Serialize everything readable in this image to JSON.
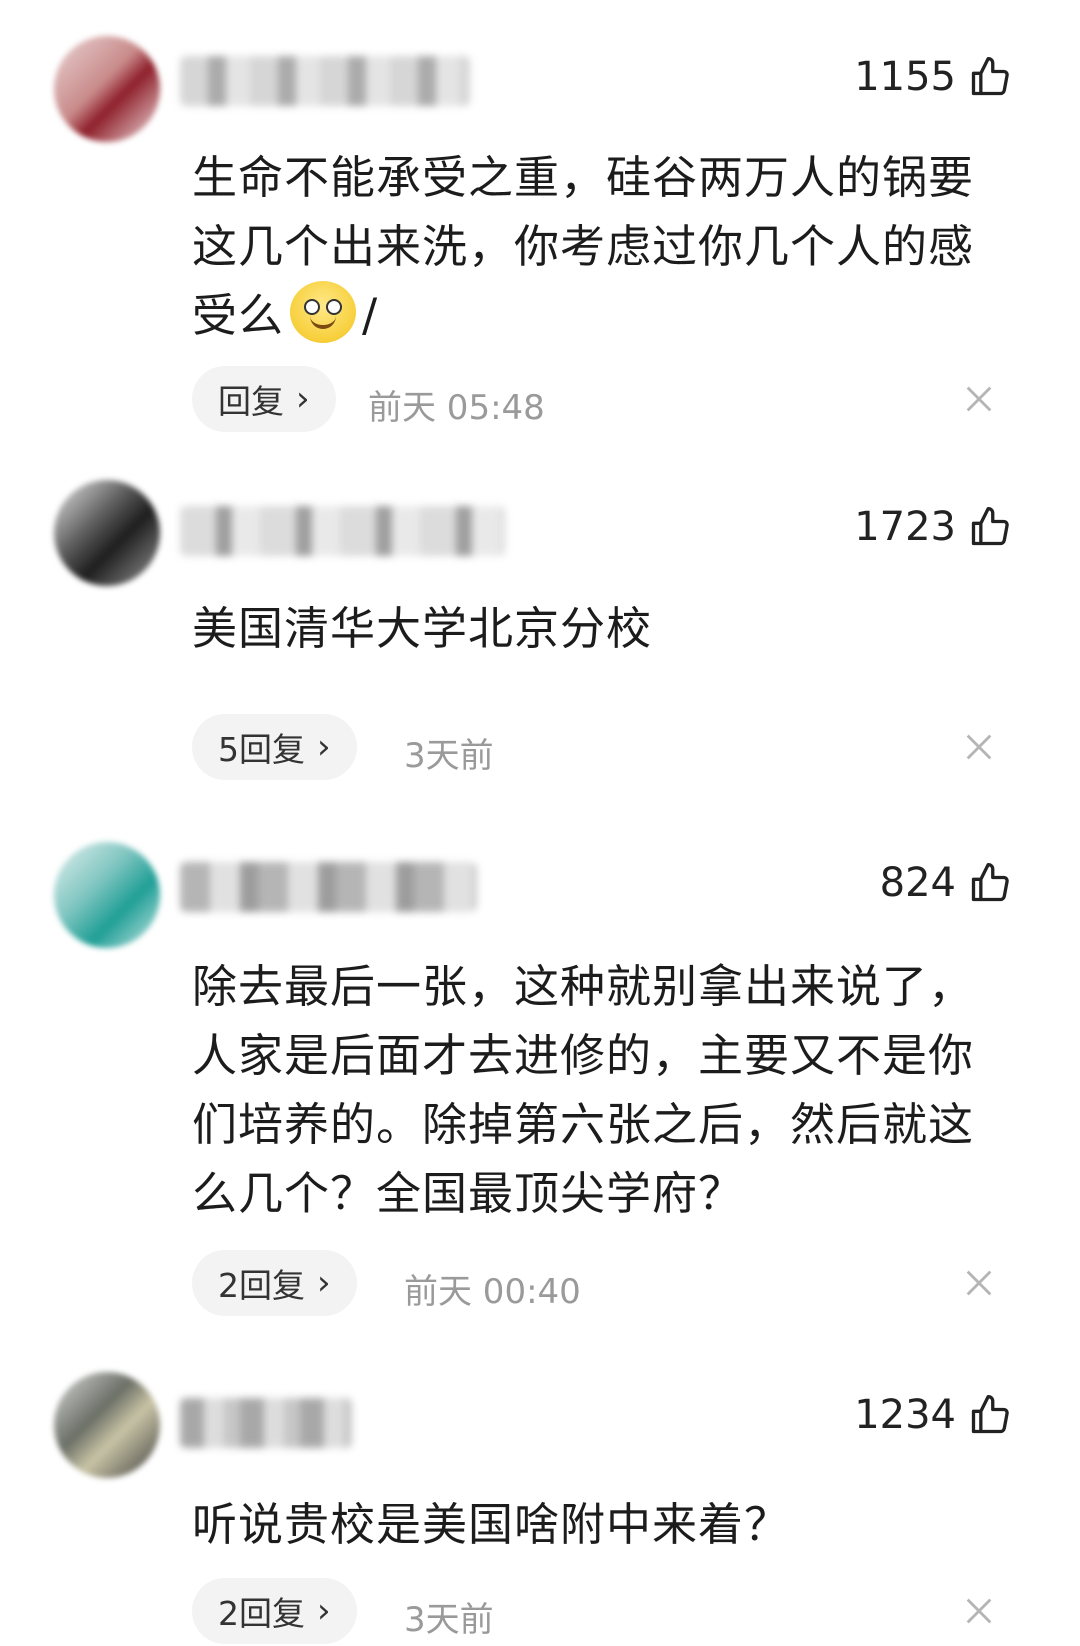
{
  "comments": [
    {
      "likes": "1155",
      "text": "生命不能承受之重，硅谷两万人的锅要这几个出来洗，你考虑过你几个人的感受么",
      "text_suffix": "/",
      "emoji": "smile-emoji",
      "reply_label": "回复",
      "time": "前天  05:48"
    },
    {
      "likes": "1723",
      "text": "美国清华大学北京分校",
      "reply_label": "5回复",
      "time": "3天前"
    },
    {
      "likes": "824",
      "text": "除去最后一张，这种就别拿出来说了，人家是后面才去进修的，主要又不是你们培养的。除掉第六张之后，然后就这么几个？全国最顶尖学府？",
      "reply_label": "2回复",
      "time": "前天  00:40"
    },
    {
      "likes": "1234",
      "text": "听说贵校是美国啥附中来着？",
      "reply_label": "2回复",
      "time": "3天前"
    }
  ],
  "icons": {
    "like": "thumbs-up-icon",
    "close": "close-icon",
    "reply_chevron": "chevron-right-icon"
  },
  "colors": {
    "text": "#1c1c1c",
    "meta": "#9a9a9a",
    "reply_bg": "#f3f3f3"
  }
}
